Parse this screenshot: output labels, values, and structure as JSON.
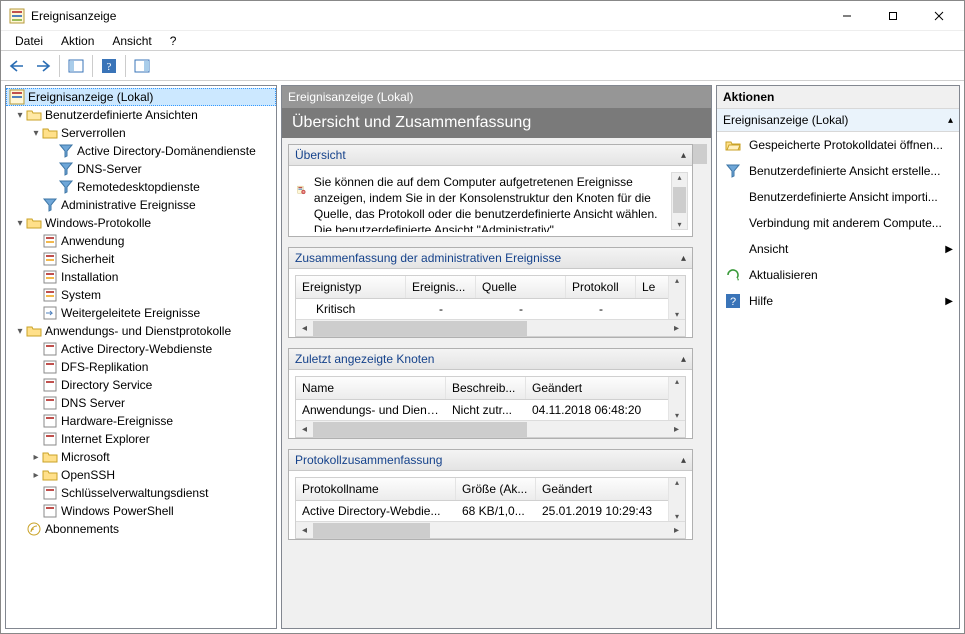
{
  "window_title": "Ereignisanzeige",
  "menubar": [
    "Datei",
    "Aktion",
    "Ansicht",
    "?"
  ],
  "tree": {
    "root": "Ereignisanzeige (Lokal)",
    "custom_views": "Benutzerdefinierte Ansichten",
    "server_roles": "Serverrollen",
    "adds": "Active Directory-Domänendienste",
    "dns": "DNS-Server",
    "rds": "Remotedesktopdienste",
    "admin_events": "Administrative Ereignisse",
    "win_logs": "Windows-Protokolle",
    "app": "Anwendung",
    "sec": "Sicherheit",
    "inst": "Installation",
    "sys": "System",
    "fwd": "Weitergeleitete Ereignisse",
    "app_svc": "Anwendungs- und Dienstprotokolle",
    "adweb": "Active Directory-Webdienste",
    "dfs": "DFS-Replikation",
    "dirsvc": "Directory Service",
    "dnsserver": "DNS Server",
    "hw": "Hardware-Ereignisse",
    "ie": "Internet Explorer",
    "ms": "Microsoft",
    "openssh": "OpenSSH",
    "keymgmt": "Schlüsselverwaltungsdienst",
    "ps": "Windows PowerShell",
    "subs": "Abonnements"
  },
  "center_header": "Ereignisanzeige (Lokal)",
  "center_title": "Übersicht und Zusammenfassung",
  "sections": {
    "overview": "Übersicht",
    "overview_text": "Sie können die auf dem Computer aufgetretenen Ereignisse anzeigen, indem Sie in der Konsolenstruktur den Knoten für die Quelle, das Protokoll oder die benutzerdefinierte Ansicht wählen. Die benutzerdefinierte Ansicht \"Administrativ\"",
    "summary": "Zusammenfassung der administrativen Ereignisse",
    "summary_cols": [
      "Ereignistyp",
      "Ereignis...",
      "Quelle",
      "Protokoll",
      "Le"
    ],
    "summary_row": [
      "Kritisch",
      "-",
      "-",
      "-"
    ],
    "recent": "Zuletzt angezeigte Knoten",
    "recent_cols": [
      "Name",
      "Beschreib...",
      "Geändert"
    ],
    "recent_row": [
      "Anwendungs- und Diens...",
      "Nicht zutr...",
      "04.11.2018 06:48:20"
    ],
    "logsum": "Protokollzusammenfassung",
    "logsum_cols": [
      "Protokollname",
      "Größe (Ak...",
      "Geändert"
    ],
    "logsum_row": [
      "Active Directory-Webdie...",
      "68 KB/1,0...",
      "25.01.2019 10:29:43"
    ]
  },
  "actions_header": "Aktionen",
  "actions_sub": "Ereignisanzeige (Lokal)",
  "actions": {
    "open_log": "Gespeicherte Protokolldatei öffnen...",
    "create_view": "Benutzerdefinierte Ansicht erstelle...",
    "import_view": "Benutzerdefinierte Ansicht importi...",
    "connect": "Verbindung mit anderem Compute...",
    "view": "Ansicht",
    "refresh": "Aktualisieren",
    "help": "Hilfe"
  }
}
